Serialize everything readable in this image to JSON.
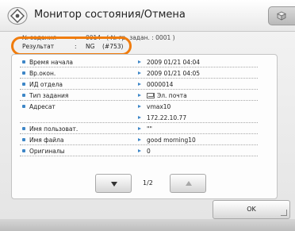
{
  "title": "Монитор состояния/Отмена",
  "header": {
    "row1": {
      "label": "№ задания",
      "value": "0014",
      "extra": "( № гр. задан.     : 0001 )"
    },
    "row2": {
      "label": "Результат",
      "value": "NG",
      "code": "(#753)"
    }
  },
  "details": [
    {
      "label": "Время начала",
      "value": "2009 01/21 04:04"
    },
    {
      "label": "Вр.окон.",
      "value": "2009 01/21 04:05"
    },
    {
      "label": "ИД отдела",
      "value": "0000014"
    },
    {
      "label": "Тип задания",
      "value": "Эл. почта",
      "icon": "mail-icon"
    },
    {
      "label": "Адресат",
      "value": "vmax10"
    },
    {
      "label": "",
      "value": "172.22.10.77"
    },
    {
      "label": "Имя пользоват.",
      "value": "\"\""
    },
    {
      "label": "Имя файла",
      "value": "good morning10"
    },
    {
      "label": "Оригиналы",
      "value": "0"
    }
  ],
  "pager": {
    "page": "1/2"
  },
  "footer": {
    "ok_label": "OK"
  },
  "colors": {
    "highlight": "#f07c0d",
    "accent": "#3d86c7"
  }
}
